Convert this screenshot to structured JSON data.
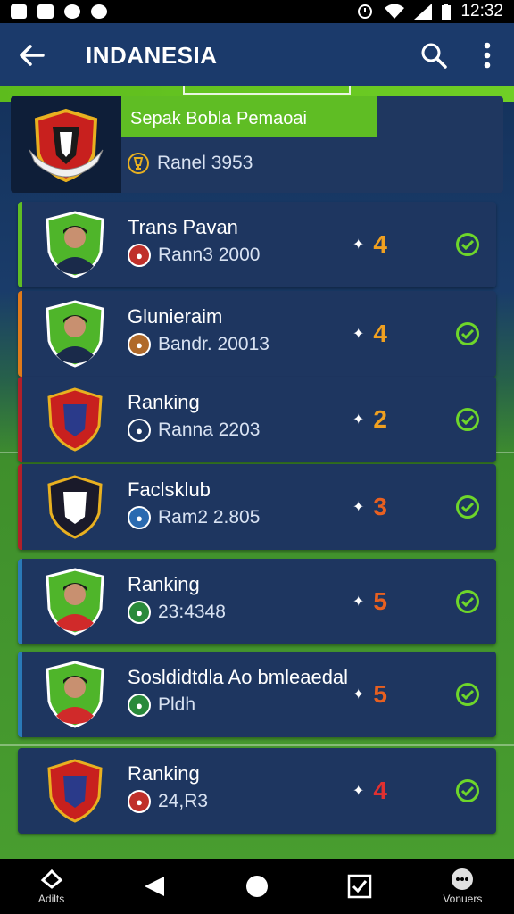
{
  "status_bar": {
    "time": "12:32"
  },
  "app_bar": {
    "title": "INDANESIA"
  },
  "header": {
    "tag": "Sepak Bobla Pemaoai",
    "rank": "Ranel 3953"
  },
  "players": [
    {
      "name": "Trans Pavan",
      "sub": "Rann3 2000",
      "score": "4",
      "score_color": "#f0a020",
      "accent": "#5fbd24",
      "badge_color": "#c0302a"
    },
    {
      "name": "Glunieraim",
      "sub": "Bandr. 20013",
      "score": "4",
      "score_color": "#f0a020",
      "accent": "#e07a1a",
      "badge_color": "#b06a2a"
    },
    {
      "name": "Ranking",
      "sub": "Ranna 2203",
      "score": "2",
      "score_color": "#f0a020",
      "accent": "#b0202a",
      "badge_color": "#1e3660"
    },
    {
      "name": "Faclsklub",
      "sub": "Ram2 2.805",
      "score": "3",
      "score_color": "#e86020",
      "accent": "#b0202a",
      "badge_color": "#2a6ab0"
    },
    {
      "name": "Ranking",
      "sub": "23:4348",
      "score": "5",
      "score_color": "#e86020",
      "accent": "#2a7ab8",
      "badge_color": "#2a8a3a"
    },
    {
      "name": "Sosldidtdla Ao bmleaedal",
      "sub": "Pldh",
      "score": "5",
      "score_color": "#e86020",
      "accent": "#2a7ab8",
      "badge_color": "#2a8a3a"
    },
    {
      "name": "Ranking",
      "sub": "24,R3",
      "score": "4",
      "score_color": "#e03030",
      "accent": "#1e3660",
      "badge_color": "#c0302a"
    }
  ],
  "nav": {
    "left_label": "Adilts",
    "right_label": "Vonuers"
  }
}
